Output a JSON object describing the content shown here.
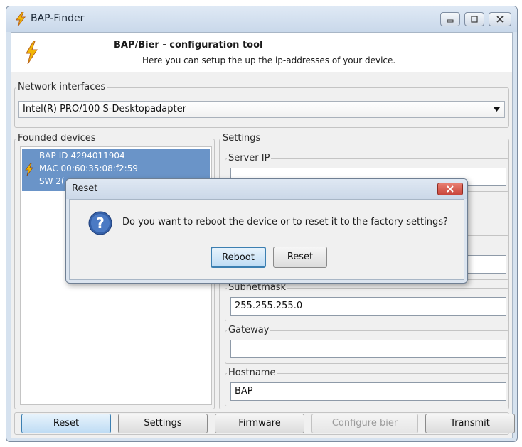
{
  "window": {
    "title": "BAP-Finder",
    "icon": "lightning-bolt-icon",
    "controls": {
      "minimize": "minimize-icon",
      "maximize": "maximize-icon",
      "close": "close-icon"
    }
  },
  "header": {
    "title": "BAP/Bier - configuration tool",
    "subtitle": "Here you can setup the up the ip-addresses of your device."
  },
  "network_interfaces": {
    "label": "Network interfaces",
    "selected": "Intel(R) PRO/100 S-Desktopadapter"
  },
  "devices": {
    "label": "Founded devices",
    "items": [
      {
        "bap_id": "BAP-ID 4294011904",
        "mac": "MAC 00:60:35:08:f2:59",
        "sw": "SW 2(",
        "icon": "lightning-bolt-icon"
      }
    ]
  },
  "settings": {
    "label": "Settings",
    "server_ip": {
      "label": "Server IP",
      "value": ""
    },
    "subnetmask": {
      "label": "Subnetmask",
      "value": "255.255.255.0"
    },
    "gateway": {
      "label": "Gateway",
      "value": ""
    },
    "hostname": {
      "label": "Hostname",
      "value": "BAP"
    }
  },
  "toolbar": {
    "reset": "Reset",
    "settings": "Settings",
    "firmware": "Firmware",
    "configure_bier": "Configure bier",
    "transmit": "Transmit"
  },
  "dialog": {
    "title": "Reset",
    "icon": "question-icon",
    "message": "Do you want to reboot the device or to reset it to the factory settings?",
    "reboot_label": "Reboot",
    "reset_label": "Reset",
    "close_icon": "close-icon"
  },
  "colors": {
    "selection": "#6a94c8",
    "dialog_close": "#c8443a",
    "bolt": "#f2b705"
  }
}
